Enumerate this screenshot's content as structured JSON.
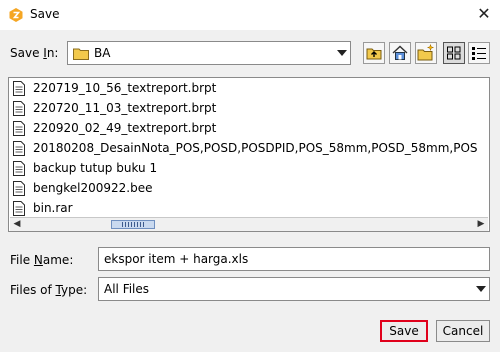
{
  "window": {
    "title": "Save",
    "close_glyph": "✕"
  },
  "save_in": {
    "label_pre": "Save ",
    "label_u": "I",
    "label_post": "n:",
    "value": "BA",
    "icon": "folder-icon"
  },
  "toolbar": [
    {
      "name": "up-one-level-button",
      "icon": "folder-up-icon"
    },
    {
      "name": "home-button",
      "icon": "home-icon"
    },
    {
      "name": "create-new-folder-button",
      "icon": "new-folder-icon"
    },
    {
      "name": "list-view-button",
      "icon": "list-view-icon",
      "active": true
    },
    {
      "name": "details-view-button",
      "icon": "details-view-icon"
    }
  ],
  "files": [
    {
      "name": "220719_10_56_textreport.brpt"
    },
    {
      "name": "220720_11_03_textreport.brpt"
    },
    {
      "name": "220920_02_49_textreport.brpt"
    },
    {
      "name": "20180208_DesainNota_POS,POSD,POSDPID,POS_58mm,POSD_58mm,POS"
    },
    {
      "name": "backup tutup buku 1"
    },
    {
      "name": "bengkel200922.bee"
    },
    {
      "name": "bin.rar"
    }
  ],
  "scrollbar": {
    "left_arrow": "◀",
    "right_arrow": "▶"
  },
  "file_name": {
    "label_pre": "File ",
    "label_u": "N",
    "label_post": "ame:",
    "value": "ekspor item + harga.xls"
  },
  "file_type": {
    "label_pre": "Files of ",
    "label_u": "T",
    "label_post": "ype:",
    "value": "All Files"
  },
  "buttons": {
    "save": "Save",
    "cancel": "Cancel"
  },
  "colors": {
    "highlight": "#e0001b",
    "folder": "#f2c94c",
    "app_icon": "#f5a623"
  }
}
